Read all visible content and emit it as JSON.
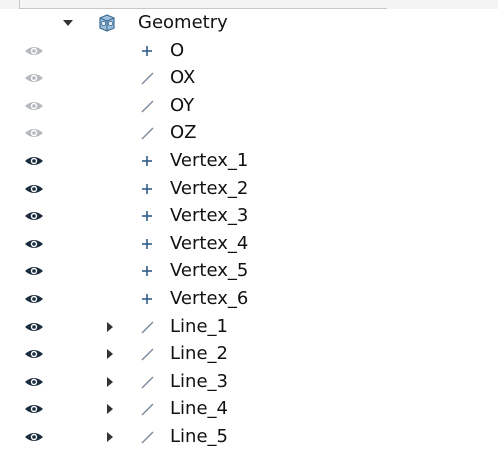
{
  "tree": {
    "root": {
      "label": "Geometry",
      "icon": "geometry-group-icon"
    },
    "items": [
      {
        "label": "O",
        "kind": "point",
        "icon": "point-icon",
        "visible": false,
        "expandable": false
      },
      {
        "label": "OX",
        "kind": "line",
        "icon": "line-icon",
        "visible": false,
        "expandable": false
      },
      {
        "label": "OY",
        "kind": "line",
        "icon": "line-icon",
        "visible": false,
        "expandable": false
      },
      {
        "label": "OZ",
        "kind": "line",
        "icon": "line-icon",
        "visible": false,
        "expandable": false
      },
      {
        "label": "Vertex_1",
        "kind": "point",
        "icon": "point-icon",
        "visible": true,
        "expandable": false
      },
      {
        "label": "Vertex_2",
        "kind": "point",
        "icon": "point-icon",
        "visible": true,
        "expandable": false
      },
      {
        "label": "Vertex_3",
        "kind": "point",
        "icon": "point-icon",
        "visible": true,
        "expandable": false
      },
      {
        "label": "Vertex_4",
        "kind": "point",
        "icon": "point-icon",
        "visible": true,
        "expandable": false
      },
      {
        "label": "Vertex_5",
        "kind": "point",
        "icon": "point-icon",
        "visible": true,
        "expandable": false
      },
      {
        "label": "Vertex_6",
        "kind": "point",
        "icon": "point-icon",
        "visible": true,
        "expandable": false
      },
      {
        "label": "Line_1",
        "kind": "line",
        "icon": "line-icon",
        "visible": true,
        "expandable": true
      },
      {
        "label": "Line_2",
        "kind": "line",
        "icon": "line-icon",
        "visible": true,
        "expandable": true
      },
      {
        "label": "Line_3",
        "kind": "line",
        "icon": "line-icon",
        "visible": true,
        "expandable": true
      },
      {
        "label": "Line_4",
        "kind": "line",
        "icon": "line-icon",
        "visible": true,
        "expandable": true
      },
      {
        "label": "Line_5",
        "kind": "line",
        "icon": "line-icon",
        "visible": true,
        "expandable": true
      }
    ]
  },
  "colors": {
    "point_icon": "#2f5d8a",
    "line_icon": "#7a8a9a",
    "eye": "#1b2c3e",
    "expander": "#333333",
    "geometry_icon_fill": "#9fc0dc",
    "geometry_icon_stroke": "#3d6b92"
  }
}
